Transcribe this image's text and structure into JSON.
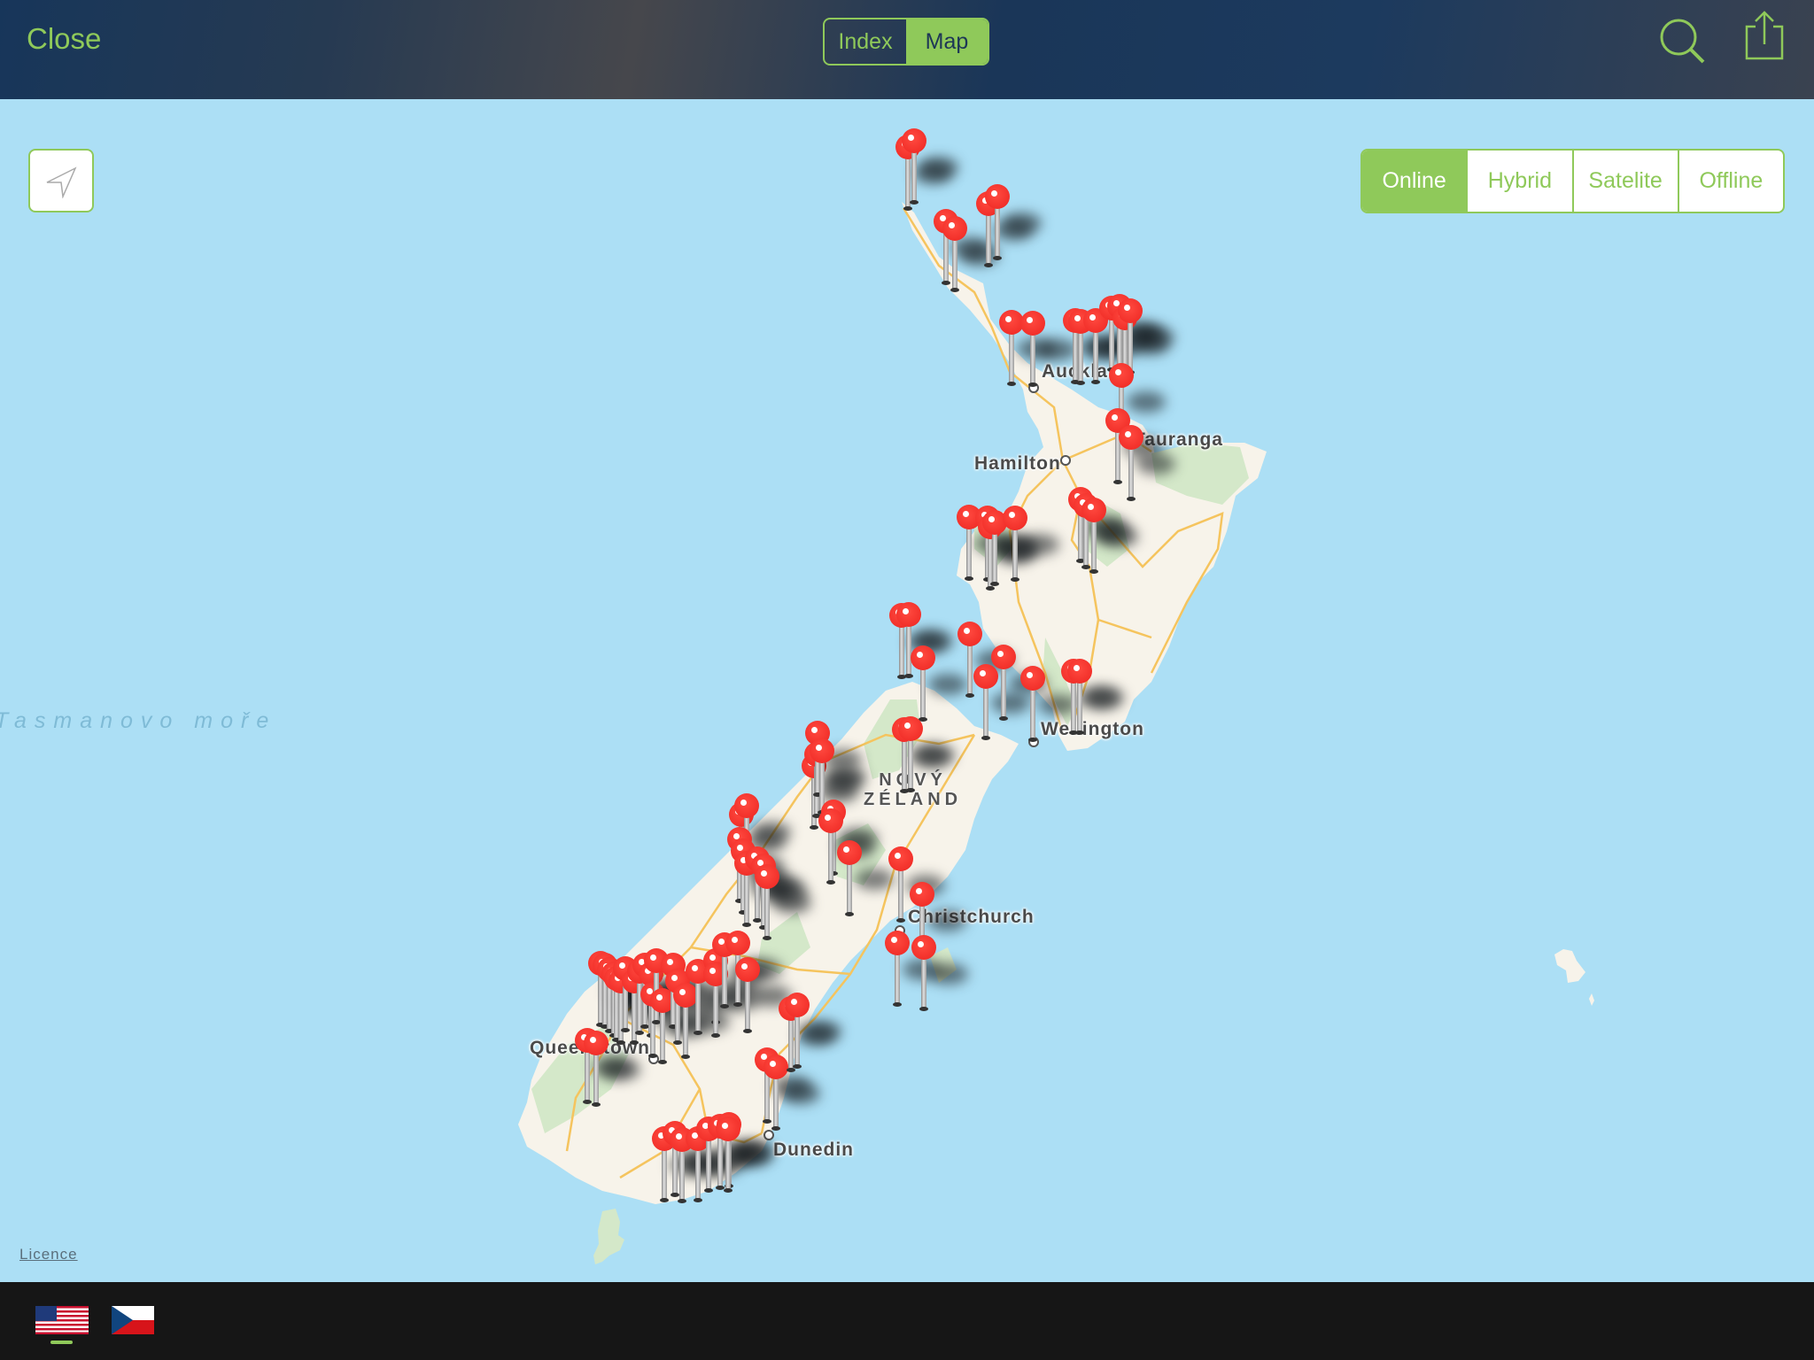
{
  "header": {
    "close_label": "Close",
    "view_tabs": [
      {
        "label": "Index",
        "active": false
      },
      {
        "label": "Map",
        "active": true
      }
    ],
    "icons": [
      "search-icon",
      "share-icon"
    ]
  },
  "map": {
    "type_tabs": [
      {
        "label": "Online",
        "active": true
      },
      {
        "label": "Hybrid",
        "active": false
      },
      {
        "label": "Satelite",
        "active": false
      },
      {
        "label": "Offline",
        "active": false
      }
    ],
    "sea_label": "Tasmanovo moře",
    "country_label": {
      "line1": "NOVÝ",
      "line2": "ZÉLAND"
    },
    "cities": [
      {
        "name": "Auckland"
      },
      {
        "name": "Tauranga"
      },
      {
        "name": "Hamilton"
      },
      {
        "name": "Wellington"
      },
      {
        "name": "Christchurch"
      },
      {
        "name": "Queenstown"
      },
      {
        "name": "Dunedin"
      }
    ],
    "locate_icon": "location-arrow-icon",
    "licence_label": "Licence",
    "pin_color": "#f2302a",
    "pin_count": 88
  },
  "footer": {
    "languages": [
      {
        "name": "English (US)",
        "icon": "us-flag-icon",
        "selected": true
      },
      {
        "name": "Czech",
        "icon": "czech-flag-icon",
        "selected": false
      }
    ]
  },
  "colors": {
    "accent": "#8fc95a",
    "sea": "#acdff5",
    "land": "#f7f3ea",
    "forest": "#d4e8c9",
    "road": "#f5c45e",
    "header_bg": "#1b3658",
    "footer_bg": "#161616"
  }
}
